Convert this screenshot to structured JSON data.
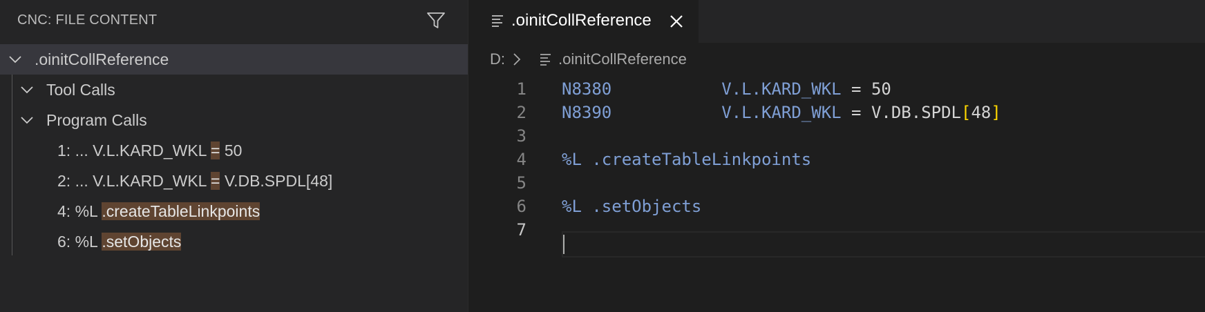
{
  "sidebar": {
    "title": "CNC: FILE CONTENT",
    "filter_icon": "filter-icon",
    "root": {
      "label": ".oinitCollReference"
    },
    "groups": [
      {
        "label": "Tool Calls"
      },
      {
        "label": "Program Calls"
      }
    ],
    "items": [
      {
        "prefix": "1: ... V.L.KARD_WKL ",
        "match": "=",
        "suffix": " 50"
      },
      {
        "prefix": "2: ... V.L.KARD_WKL ",
        "match": "=",
        "suffix": " V.DB.SPDL[48]"
      },
      {
        "prefix": "4: %L ",
        "match": ".createTableLinkpoints",
        "suffix": ""
      },
      {
        "prefix": "6: %L ",
        "match": ".setObjects",
        "suffix": ""
      }
    ]
  },
  "editor": {
    "tab": {
      "label": ".oinitCollReference",
      "close_icon": "close-icon"
    },
    "breadcrumb": {
      "drive": "D:",
      "file": ".oinitCollReference"
    },
    "lines": [
      {
        "num": "1",
        "block": "N8380",
        "gap": "           ",
        "var": "V.L.KARD_WKL",
        "op": " = ",
        "rest": "50",
        "bo": "",
        "idx": "",
        "bc": ""
      },
      {
        "num": "2",
        "block": "N8390",
        "gap": "           ",
        "var": "V.L.KARD_WKL",
        "op": " = ",
        "rest": "V.DB.SPDL",
        "bo": "[",
        "idx": "48",
        "bc": "]"
      },
      {
        "num": "3"
      },
      {
        "num": "4",
        "macro": "%L .createTableLinkpoints"
      },
      {
        "num": "5"
      },
      {
        "num": "6",
        "macro": "%L .setObjects"
      },
      {
        "num": "7"
      }
    ]
  },
  "colors": {
    "accent_highlight": "#5f4431",
    "keyword": "#7f9fd5",
    "bracket": "#ffd700"
  }
}
